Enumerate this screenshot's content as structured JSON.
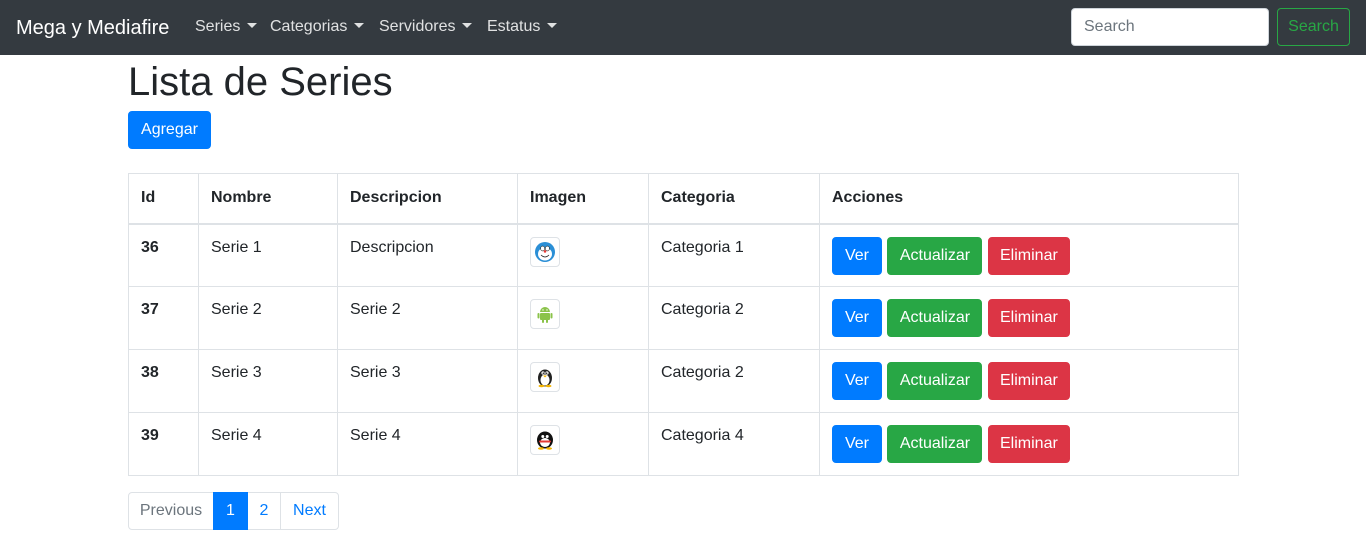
{
  "navbar": {
    "brand": "Mega y Mediafire",
    "menus": [
      {
        "label": "Series"
      },
      {
        "label": "Categorias"
      },
      {
        "label": "Servidores"
      },
      {
        "label": "Estatus"
      }
    ],
    "search": {
      "placeholder": "Search",
      "value": "",
      "button_label": "Search"
    }
  },
  "main": {
    "title": "Lista de Series",
    "add_label": "Agregar",
    "table": {
      "headers": {
        "id": "Id",
        "nombre": "Nombre",
        "descripcion": "Descripcion",
        "imagen": "Imagen",
        "categoria": "Categoria",
        "acciones": "Acciones"
      },
      "rows": [
        {
          "id": "36",
          "nombre": "Serie 1",
          "descripcion": "Descripcion",
          "icon": "doraemon-icon",
          "categoria": "Categoria 1"
        },
        {
          "id": "37",
          "nombre": "Serie 2",
          "descripcion": "Serie 2",
          "icon": "android-icon",
          "categoria": "Categoria 2"
        },
        {
          "id": "38",
          "nombre": "Serie 3",
          "descripcion": "Serie 3",
          "icon": "penguin-icon",
          "categoria": "Categoria 2"
        },
        {
          "id": "39",
          "nombre": "Serie 4",
          "descripcion": "Serie 4",
          "icon": "qq-penguin-icon",
          "categoria": "Categoria 4"
        }
      ],
      "actions": {
        "ver": "Ver",
        "actualizar": "Actualizar",
        "eliminar": "Eliminar"
      }
    },
    "pagination": {
      "previous": "Previous",
      "pages": [
        "1",
        "2"
      ],
      "active_page": "1",
      "next": "Next"
    }
  },
  "colors": {
    "navbar_bg": "#343a40",
    "primary": "#007bff",
    "success": "#28a745",
    "danger": "#dc3545"
  }
}
